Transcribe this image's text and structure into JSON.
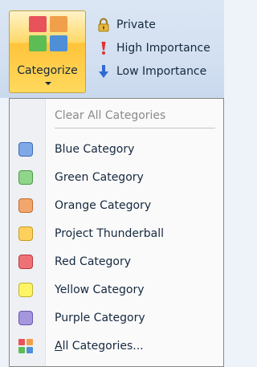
{
  "ribbon": {
    "categorize": {
      "label": "Categorize",
      "icon": "categorize-grid-icon",
      "icon_colors": [
        "#e8525b",
        "#f0a04a",
        "#5dbd55",
        "#4e8fd8"
      ]
    },
    "buttons": [
      {
        "label": "Private",
        "icon": "lock-icon"
      },
      {
        "label": "High Importance",
        "icon": "exclamation-icon",
        "color": "#e03030"
      },
      {
        "label": "Low Importance",
        "icon": "down-arrow-icon",
        "color": "#2f6bd1"
      }
    ]
  },
  "menu": {
    "clear_label": "Clear All Categories",
    "items": [
      {
        "label": "Blue Category",
        "color": "#7fa8e6",
        "border": "#3e6bb4"
      },
      {
        "label": "Green Category",
        "color": "#8fd58a",
        "border": "#4c9a46"
      },
      {
        "label": "Orange Category",
        "color": "#f3a66b",
        "border": "#c26b2e"
      },
      {
        "label": "Project Thunderball",
        "color": "#ffd15c",
        "border": "#c79a21"
      },
      {
        "label": "Red Category",
        "color": "#ee7176",
        "border": "#b63a41"
      },
      {
        "label": "Yellow Category",
        "color": "#fdf466",
        "border": "#bfb52a"
      },
      {
        "label": "Purple Category",
        "color": "#a596dd",
        "border": "#6a56b0"
      }
    ],
    "all_label": "All Categories..."
  }
}
